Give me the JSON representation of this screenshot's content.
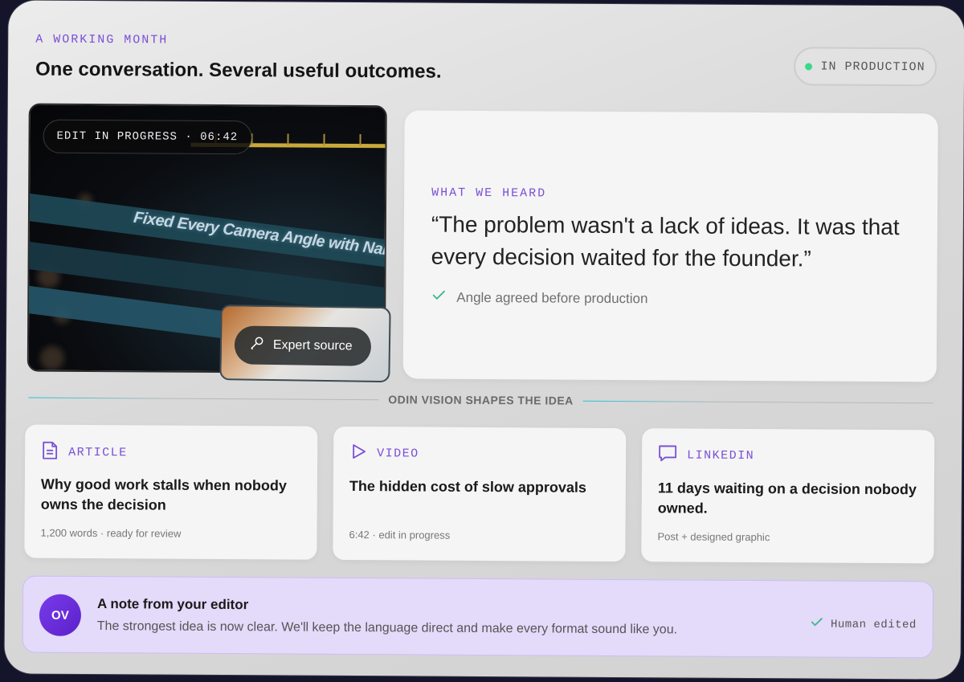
{
  "header": {
    "eyebrow": "A WORKING MONTH",
    "title": "One conversation. Several useful outcomes.",
    "status": {
      "label": "IN PRODUCTION",
      "dot_color": "#39d98a"
    }
  },
  "video": {
    "badge": "EDIT IN PROGRESS · 06:42",
    "track_label": "Fixed Every Camera Angle with Nano Bana",
    "expert_button": "Expert source"
  },
  "quote": {
    "eyebrow": "WHAT WE HEARD",
    "text": "“The problem wasn't a lack of ideas. It was that every decision waited for the founder.”",
    "check_label": "Angle agreed before production"
  },
  "divider": {
    "label": "ODIN VISION SHAPES THE IDEA"
  },
  "formats": [
    {
      "type": "ARTICLE",
      "icon": "document-icon",
      "title": "Why good work stalls when nobody owns the decision",
      "meta": "1,200 words · ready for review"
    },
    {
      "type": "VIDEO",
      "icon": "play-icon",
      "title": "The hidden cost of slow approvals",
      "meta": "6:42 · edit in progress"
    },
    {
      "type": "LINKEDIN",
      "icon": "chat-bubble-icon",
      "title": "11 days waiting on a decision nobody owned.",
      "meta": "Post + designed graphic"
    }
  ],
  "note": {
    "avatar": "OV",
    "title": "A note from your editor",
    "body": "The strongest idea is now clear. We'll keep the language direct and make every format sound like you.",
    "badge": "Human edited"
  },
  "colors": {
    "accent": "#7a4fd6",
    "check": "#3db88a",
    "note_bg": "#e4dafa"
  }
}
